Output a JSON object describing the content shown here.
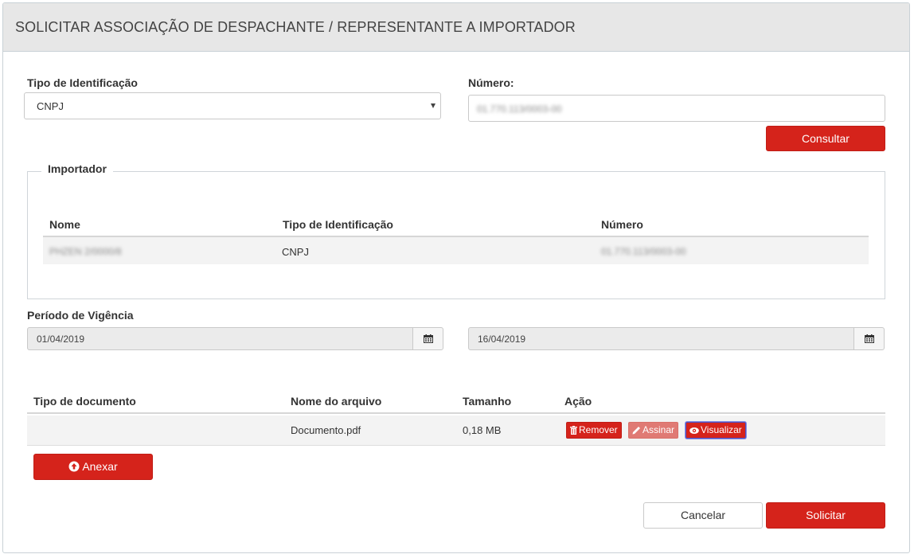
{
  "page": {
    "title": "SOLICITAR ASSOCIAÇÃO DE DESPACHANTE / REPRESENTANTE A IMPORTADOR"
  },
  "identification": {
    "type_label": "Tipo de Identificação",
    "type_value": "CNPJ",
    "number_label": "Número:",
    "number_value": "01.770.113/0003-00",
    "consult_button": "Consultar"
  },
  "importer": {
    "legend": "Importador",
    "columns": [
      "Nome",
      "Tipo de Identificação",
      "Número"
    ],
    "rows": [
      {
        "nome": "PHZEN 2/0000/8",
        "tipo": "CNPJ",
        "numero": "01.770.113/0003-00"
      }
    ]
  },
  "validity": {
    "label": "Período de Vigência",
    "start_date": "01/04/2019",
    "end_date": "16/04/2019"
  },
  "documents": {
    "columns": [
      "Tipo de documento",
      "Nome do arquivo",
      "Tamanho",
      "Ação"
    ],
    "rows": [
      {
        "tipo": "",
        "nome": "Documento.pdf",
        "tamanho": "0,18 MB"
      }
    ],
    "actions": {
      "remove": "Remover",
      "sign": "Assinar",
      "view": "Visualizar"
    },
    "attach_button": "Anexar"
  },
  "footer": {
    "cancel_button": "Cancelar",
    "submit_button": "Solicitar"
  },
  "colors": {
    "primary_red": "#d5231b",
    "disabled_red": "#e07a74",
    "header_gray": "#e7e7e7"
  }
}
